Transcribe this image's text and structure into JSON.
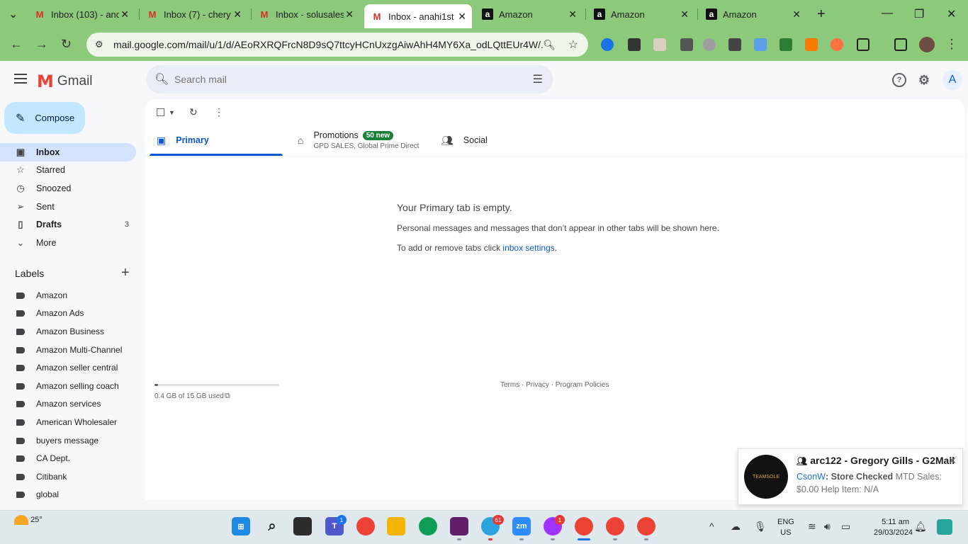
{
  "browser": {
    "tabs": [
      {
        "title": "Inbox (103) - anc",
        "favicon": "gmail-icon"
      },
      {
        "title": "Inbox (7) - chery",
        "favicon": "gmail-icon"
      },
      {
        "title": "Inbox - solusales",
        "favicon": "gmail-icon"
      },
      {
        "title": "Inbox - anahi1st",
        "favicon": "gmail-icon"
      },
      {
        "title": "Amazon",
        "favicon": "amazon-icon"
      },
      {
        "title": "Amazon",
        "favicon": "amazon-icon"
      },
      {
        "title": "Amazon",
        "favicon": "amazon-icon"
      }
    ],
    "url": "mail.google.com/mail/u/1/d/AEoRXRQFrcN8D9sQ7ttcyHCnUxzgAiwAhH4MY6Xa_odLQttEUr4W/..."
  },
  "gmail": {
    "logo_text": "Gmail",
    "search_placeholder": "Search mail",
    "compose_label": "Compose",
    "nav": [
      {
        "label": "Inbox",
        "icon": "inbox-icon",
        "count": ""
      },
      {
        "label": "Starred",
        "icon": "star-icon",
        "count": ""
      },
      {
        "label": "Snoozed",
        "icon": "clock-icon",
        "count": ""
      },
      {
        "label": "Sent",
        "icon": "send-icon",
        "count": ""
      },
      {
        "label": "Drafts",
        "icon": "draft-icon",
        "count": "3"
      },
      {
        "label": "More",
        "icon": "chevron-down-icon",
        "count": ""
      }
    ],
    "labels_title": "Labels",
    "labels": [
      "Amazon",
      "Amazon Ads",
      "Amazon Business",
      "Amazon Multi-Channel",
      "Amazon seller central",
      "Amazon selling coach",
      "Amazon services",
      "American Wholesaler",
      "buyers message",
      "CA Dept.",
      "Citibank",
      "global"
    ],
    "avatar_letter": "A",
    "category_tabs": {
      "primary": "Primary",
      "promotions": "Promotions",
      "promotions_badge": "50 new",
      "promotions_sub": "GPD SALES, Global Prime Direct",
      "social": "Social"
    },
    "empty_state": {
      "title": "Your Primary tab is empty.",
      "line1": "Personal messages and messages that don’t appear in other tabs will be shown here.",
      "line2_prefix": "To add or remove tabs click ",
      "line2_link": "inbox settings",
      "line2_suffix": "."
    },
    "storage": {
      "text": "0.4 GB of 15 GB used",
      "used_fraction": 0.027
    },
    "footer": "Terms · Privacy · Program Policies"
  },
  "notification": {
    "title": "arc122 - Gregory Gills - G2Mall",
    "logo_text": "TEAMSOLE",
    "body_highlight": "CsonW",
    "body_bold": ": Store Checked",
    "body_rest": " MTD Sales: $0.00 Help Item: N/A"
  },
  "taskbar": {
    "weather_temp": "25°",
    "teams_badge": "1",
    "telegram_badge": "61",
    "messenger_badge": "1",
    "lang_line1": "ENG",
    "lang_line2": "US",
    "time": "5:11 am",
    "date": "29/03/2024"
  }
}
